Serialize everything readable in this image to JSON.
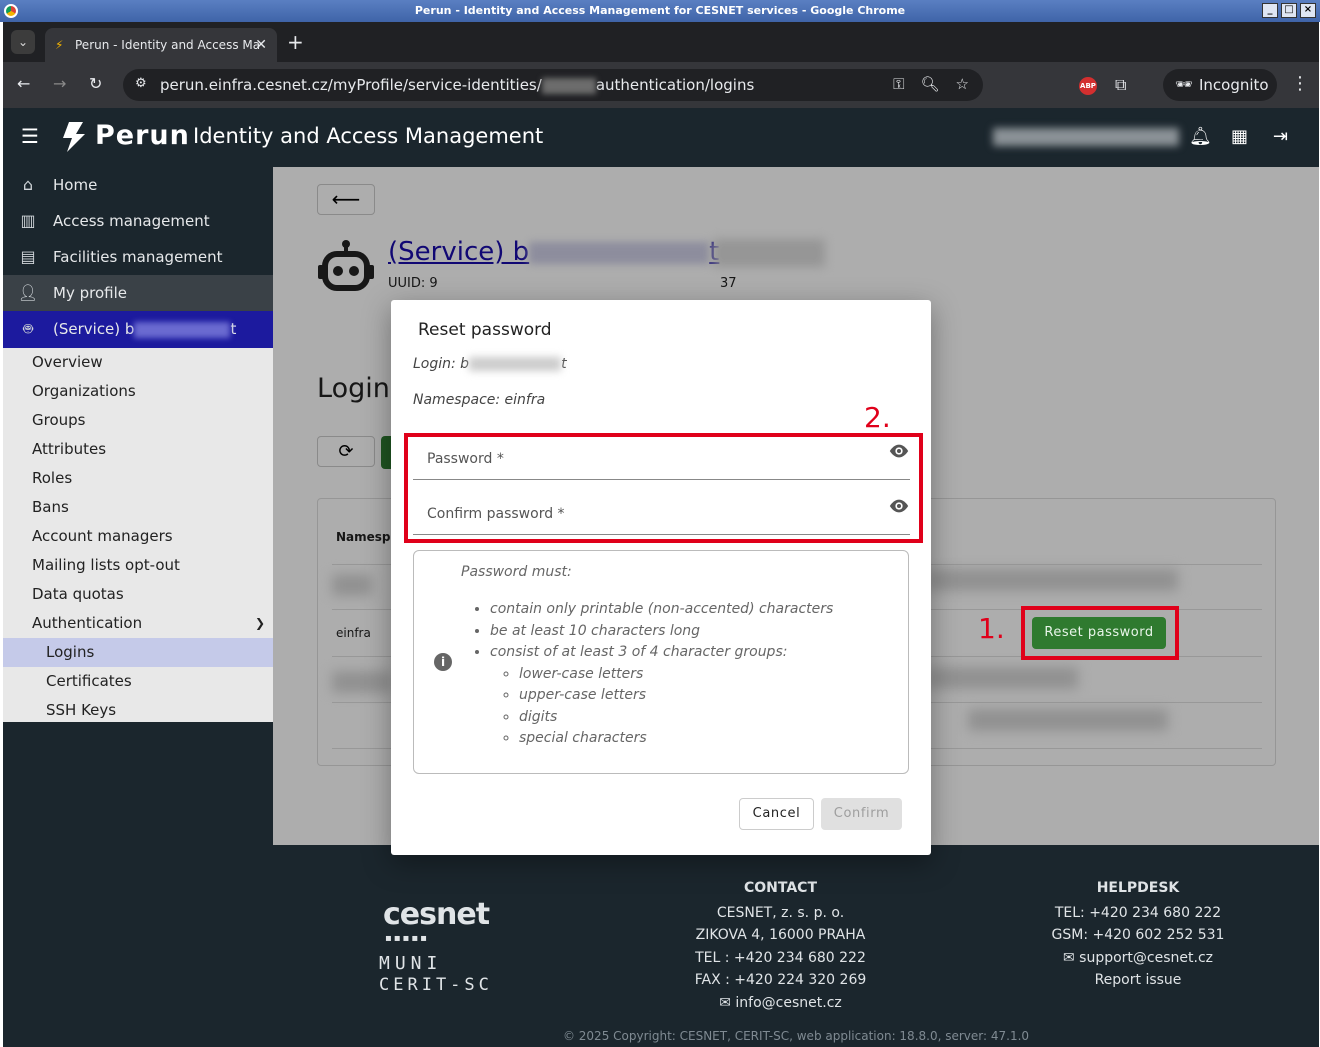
{
  "window": {
    "title": "Perun - Identity and Access Management for CESNET services - Google Chrome"
  },
  "browser": {
    "tab_title": "Perun - Identity and Access Ma",
    "url_prefix": "perun.einfra.cesnet.cz/myProfile/service-identities/",
    "url_suffix": "authentication/logins",
    "incognito_label": "Incognito"
  },
  "app": {
    "logo_text": "Perun",
    "title": "Identity and Access Management"
  },
  "sidebar": {
    "items": [
      {
        "label": "Home",
        "icon": "home-icon"
      },
      {
        "label": "Access management",
        "icon": "building-icon"
      },
      {
        "label": "Facilities management",
        "icon": "facility-icon"
      },
      {
        "label": "My profile",
        "icon": "person-icon"
      }
    ],
    "service_prefix": "(Service) b",
    "service_suffix": "t",
    "subnav": [
      "Overview",
      "Organizations",
      "Groups",
      "Attributes",
      "Roles",
      "Bans",
      "Account managers",
      "Mailing lists opt-out",
      "Data quotas",
      "Authentication"
    ],
    "auth_children": [
      "Logins",
      "Certificates",
      "SSH Keys"
    ]
  },
  "main": {
    "service_title_prefix": "(Service) b",
    "service_title_suffix": "t",
    "uuid_prefix": "UUID: 9",
    "uuid_suffix": "37",
    "logins_heading": "Logins",
    "col_namespace": "Namespa",
    "row_namespace": "einfra",
    "reset_button": "Reset password"
  },
  "dialog": {
    "title": "Reset password",
    "login_prefix": "Login: b",
    "login_suffix": "t",
    "namespace": "Namespace: einfra",
    "password_label": "Password *",
    "confirm_label": "Confirm password *",
    "requirements_title": "Password must:",
    "requirements": [
      "contain only printable (non-accented) characters",
      "be at least 10 characters long",
      "consist of at least 3 of 4 character groups:"
    ],
    "groups": [
      "lower-case letters",
      "upper-case letters",
      "digits",
      "special characters"
    ],
    "cancel": "Cancel",
    "confirm": "Confirm"
  },
  "annotations": {
    "step1": "1.",
    "step2": "2.",
    "color": "#e0001a"
  },
  "footer": {
    "logo_cesnet": "cesnet",
    "logo_muni": "MUNI",
    "logo_cerit": "CERIT-SC",
    "contact_heading": "CONTACT",
    "contact_lines": [
      "CESNET, z. s. p. o.",
      "ZIKOVA 4, 16000 PRAHA",
      "TEL : +420 234 680 222",
      "FAX : +420 224 320 269"
    ],
    "contact_email": "info@cesnet.cz",
    "helpdesk_heading": "HELPDESK",
    "helpdesk_lines": [
      "TEL: +420 234 680 222",
      "GSM: +420 602 252 531"
    ],
    "helpdesk_email": "support@cesnet.cz",
    "report_issue": "Report issue",
    "copyright": "© 2025 Copyright: CESNET, CERIT-SC, web application: 18.8.0, server: 47.1.0"
  }
}
